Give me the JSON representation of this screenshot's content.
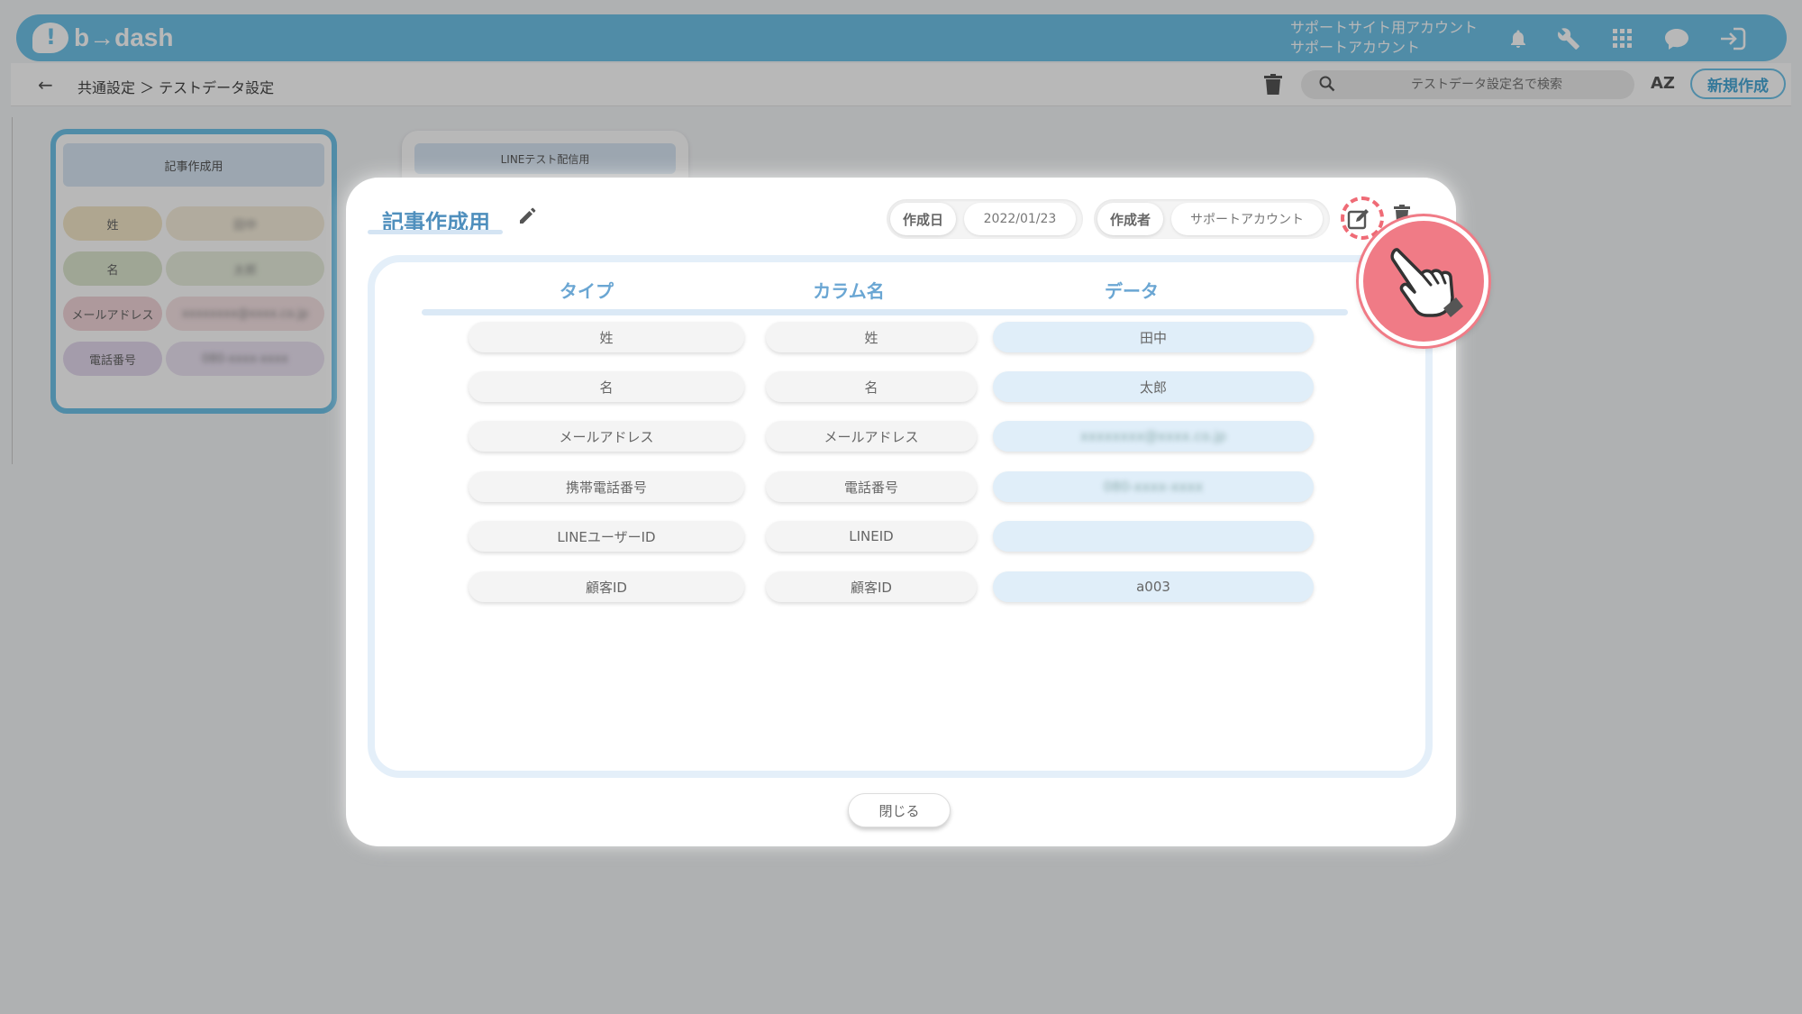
{
  "app": {
    "logo_text": "b→dash",
    "account_line1": "サポートサイト用アカウント",
    "account_line2": "サポートアカウント",
    "breadcrumb": "共通設定 ＞ テストデータ設定",
    "search_placeholder": "テストデータ設定名で検索",
    "sort_label": "AZ",
    "new_button": "新規作成",
    "brand_color": "#6fc2e8"
  },
  "background_cards": [
    {
      "title": "記事作成用",
      "rows": [
        {
          "label": "姓",
          "value": "田中",
          "color": "#f3e7c8"
        },
        {
          "label": "名",
          "value": "太郎",
          "color": "#dde6cf"
        },
        {
          "label": "メールアドレス",
          "value": "xxxxxxxx@xxxx.co.jp",
          "color": "#f2d5d8"
        },
        {
          "label": "電話番号",
          "value": "080-xxxx-xxxx",
          "color": "#e4d8ee"
        }
      ]
    },
    {
      "title": "LINEテスト配信用"
    }
  ],
  "modal": {
    "title": "記事作成用",
    "created_date_label": "作成日",
    "created_date": "2022/01/23",
    "creator_label": "作成者",
    "creator": "サポートアカウント",
    "headers": {
      "type": "タイプ",
      "column": "カラム名",
      "data": "データ"
    },
    "rows": [
      {
        "type": "姓",
        "column": "姓",
        "data": "田中",
        "blurred": false
      },
      {
        "type": "名",
        "column": "名",
        "data": "太郎",
        "blurred": false
      },
      {
        "type": "メールアドレス",
        "column": "メールアドレス",
        "data": "xxxxxxxx@xxxx.co.jp",
        "blurred": true
      },
      {
        "type": "携帯電話番号",
        "column": "電話番号",
        "data": "080-xxxx-xxxx",
        "blurred": true
      },
      {
        "type": "LINEユーザーID",
        "column": "LINEID",
        "data": "",
        "blurred": false
      },
      {
        "type": "顧客ID",
        "column": "顧客ID",
        "data": "a003",
        "blurred": false
      }
    ],
    "close_button": "閉じる",
    "accent_color": "#f07b86"
  }
}
